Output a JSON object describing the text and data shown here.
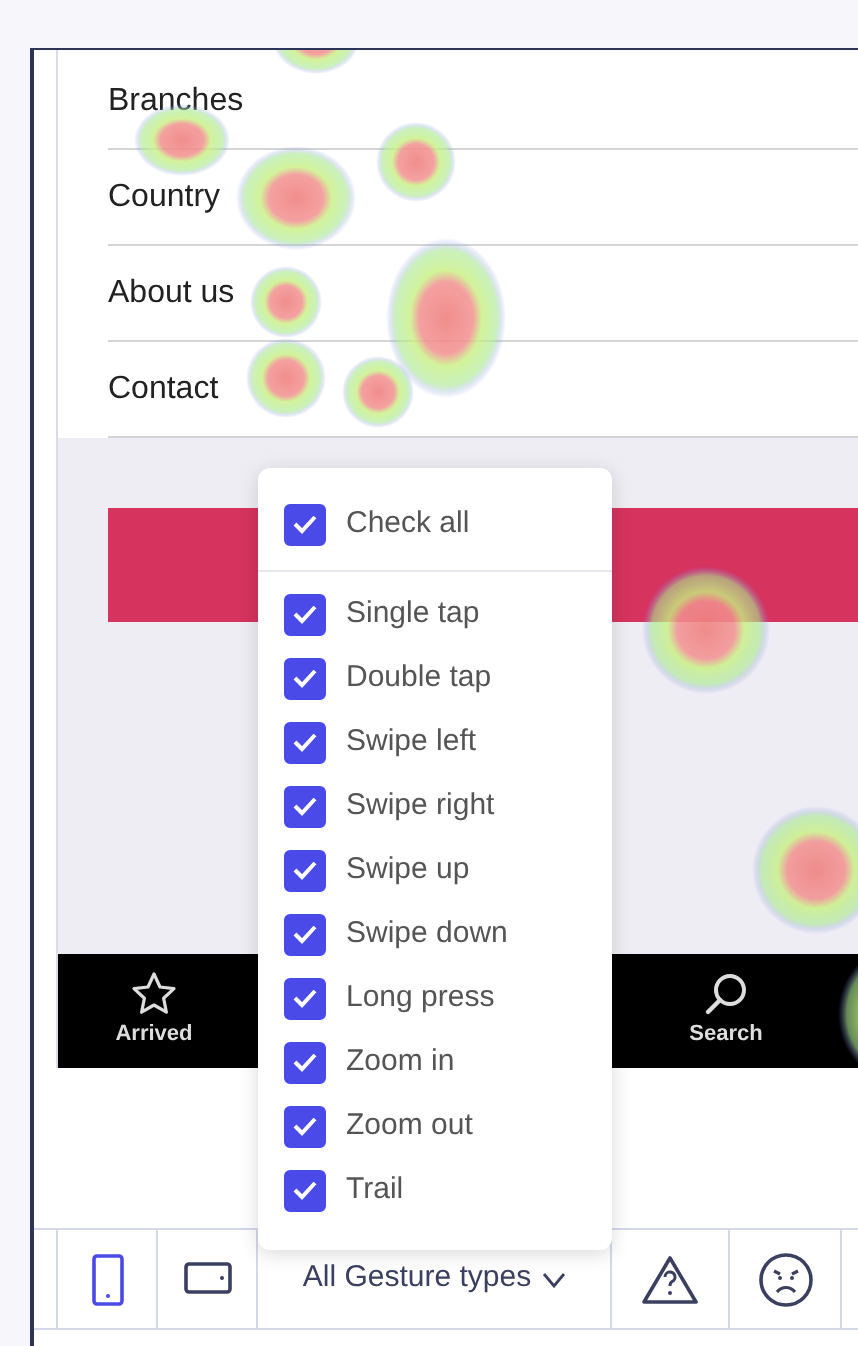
{
  "menu_items": [
    {
      "label": "Branches"
    },
    {
      "label": "Country"
    },
    {
      "label": "About us"
    },
    {
      "label": "Contact"
    }
  ],
  "bottom_nav": [
    {
      "kind": "star",
      "label": "Arrived"
    },
    {
      "kind": "search",
      "label": "Search"
    }
  ],
  "toolbar": {
    "device_buttons": [
      {
        "kind": "phone",
        "selected": true
      },
      {
        "kind": "tablet",
        "selected": false
      }
    ],
    "gesture_filter": {
      "label": "All Gesture types",
      "expanded": true
    },
    "issue_buttons": [
      {
        "kind": "warning"
      },
      {
        "kind": "frustration"
      }
    ]
  },
  "gesture_menu": {
    "check_all": {
      "label": "Check all",
      "checked": true
    },
    "items": [
      {
        "label": "Single tap",
        "checked": true
      },
      {
        "label": "Double tap",
        "checked": true
      },
      {
        "label": "Swipe left",
        "checked": true
      },
      {
        "label": "Swipe right",
        "checked": true
      },
      {
        "label": "Swipe up",
        "checked": true
      },
      {
        "label": "Swipe down",
        "checked": true
      },
      {
        "label": "Long press",
        "checked": true
      },
      {
        "label": "Zoom in",
        "checked": true
      },
      {
        "label": "Zoom out",
        "checked": true
      },
      {
        "label": "Trail",
        "checked": true
      }
    ]
  }
}
